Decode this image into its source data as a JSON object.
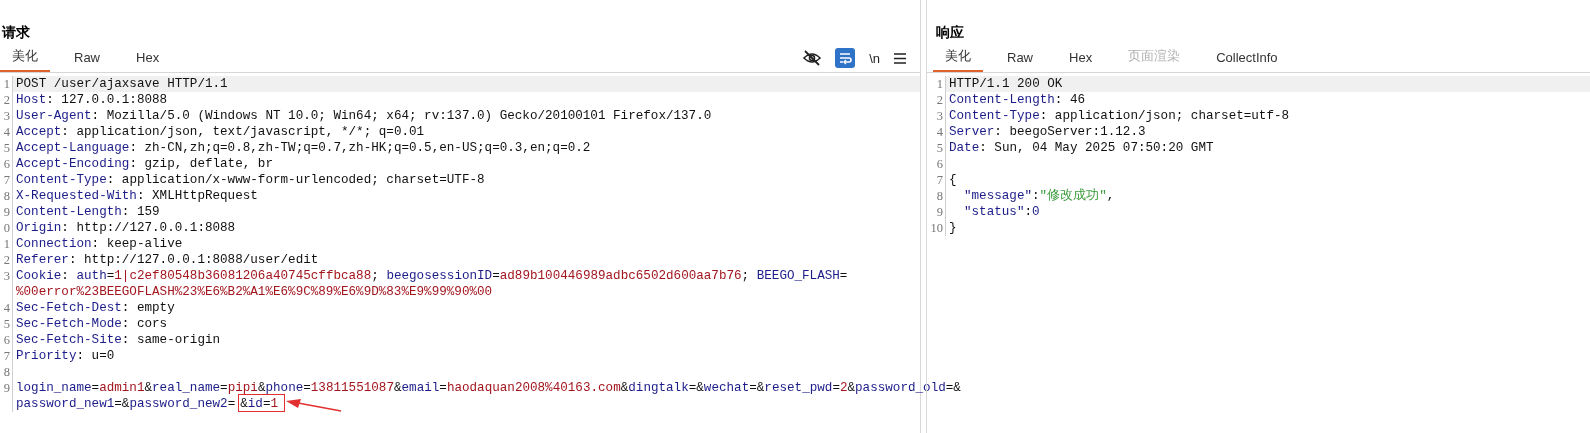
{
  "request": {
    "title": "请求",
    "tabs": [
      {
        "label": "美化",
        "selected": true,
        "disabled": false
      },
      {
        "label": "Raw",
        "selected": false,
        "disabled": false
      },
      {
        "label": "Hex",
        "selected": false,
        "disabled": false
      }
    ],
    "toolbar": [
      {
        "kind": "hide"
      },
      {
        "kind": "wrap"
      },
      {
        "kind": "text",
        "label": "\\n"
      },
      {
        "kind": "menu"
      }
    ],
    "lines": [
      {
        "number": "1",
        "current": true,
        "segments": [
          {
            "kind": "plain",
            "text": "POST /user/ajaxsave HTTP/1.1"
          }
        ]
      },
      {
        "number": "2",
        "current": false,
        "segments": [
          {
            "kind": "key",
            "text": "Host"
          },
          {
            "kind": "plain",
            "text": ": 127.0.0.1:8088"
          }
        ]
      },
      {
        "number": "3",
        "current": false,
        "segments": [
          {
            "kind": "key",
            "text": "User-Agent"
          },
          {
            "kind": "plain",
            "text": ": Mozilla/5.0 (Windows NT 10.0; Win64; x64; rv:137.0) Gecko/20100101 Firefox/137.0"
          }
        ]
      },
      {
        "number": "4",
        "current": false,
        "segments": [
          {
            "kind": "key",
            "text": "Accept"
          },
          {
            "kind": "plain",
            "text": ": application/json, text/javascript, */*; q=0.01"
          }
        ]
      },
      {
        "number": "5",
        "current": false,
        "segments": [
          {
            "kind": "key",
            "text": "Accept-Language"
          },
          {
            "kind": "plain",
            "text": ": zh-CN,zh;q=0.8,zh-TW;q=0.7,zh-HK;q=0.5,en-US;q=0.3,en;q=0.2"
          }
        ]
      },
      {
        "number": "6",
        "current": false,
        "segments": [
          {
            "kind": "key",
            "text": "Accept-Encoding"
          },
          {
            "kind": "plain",
            "text": ": gzip, deflate, br"
          }
        ]
      },
      {
        "number": "7",
        "current": false,
        "segments": [
          {
            "kind": "key",
            "text": "Content-Type"
          },
          {
            "kind": "plain",
            "text": ": application/x-www-form-urlencoded; charset=UTF-8"
          }
        ]
      },
      {
        "number": "8",
        "current": false,
        "segments": [
          {
            "kind": "key",
            "text": "X-Requested-With"
          },
          {
            "kind": "plain",
            "text": ": XMLHttpRequest"
          }
        ]
      },
      {
        "number": "9",
        "current": false,
        "segments": [
          {
            "kind": "key",
            "text": "Content-Length"
          },
          {
            "kind": "plain",
            "text": ": 159"
          }
        ]
      },
      {
        "number": "0",
        "current": false,
        "segments": [
          {
            "kind": "key",
            "text": "Origin"
          },
          {
            "kind": "plain",
            "text": ": http://127.0.0.1:8088"
          }
        ]
      },
      {
        "number": "1",
        "current": false,
        "segments": [
          {
            "kind": "key",
            "text": "Connection"
          },
          {
            "kind": "plain",
            "text": ": keep-alive"
          }
        ]
      },
      {
        "number": "2",
        "current": false,
        "segments": [
          {
            "kind": "key",
            "text": "Referer"
          },
          {
            "kind": "plain",
            "text": ": http://127.0.0.1:8088/user/edit"
          }
        ]
      },
      {
        "number": "3",
        "current": false,
        "segments": [
          {
            "kind": "key",
            "text": "Cookie"
          },
          {
            "kind": "plain",
            "text": ": "
          },
          {
            "kind": "key",
            "text": "auth"
          },
          {
            "kind": "plain",
            "text": "="
          },
          {
            "kind": "val",
            "text": "1|c2ef80548b36081206a40745cffbca88"
          },
          {
            "kind": "plain",
            "text": "; "
          },
          {
            "kind": "key",
            "text": "beegosessionID"
          },
          {
            "kind": "plain",
            "text": "="
          },
          {
            "kind": "val",
            "text": "ad89b100446989adbc6502d600aa7b76"
          },
          {
            "kind": "plain",
            "text": "; "
          },
          {
            "kind": "key",
            "text": "BEEGO_FLASH"
          },
          {
            "kind": "plain",
            "text": "="
          }
        ]
      },
      {
        "current": false,
        "segments": [
          {
            "kind": "val",
            "text": "%00error%23BEEGOFLASH%23%E6%B2%A1%E6%9C%89%E6%9D%83%E9%99%90%00"
          }
        ]
      },
      {
        "number": "4",
        "current": false,
        "segments": [
          {
            "kind": "key",
            "text": "Sec-Fetch-Dest"
          },
          {
            "kind": "plain",
            "text": ": empty"
          }
        ]
      },
      {
        "number": "5",
        "current": false,
        "segments": [
          {
            "kind": "key",
            "text": "Sec-Fetch-Mode"
          },
          {
            "kind": "plain",
            "text": ": cors"
          }
        ]
      },
      {
        "number": "6",
        "current": false,
        "segments": [
          {
            "kind": "key",
            "text": "Sec-Fetch-Site"
          },
          {
            "kind": "plain",
            "text": ": same-origin"
          }
        ]
      },
      {
        "number": "7",
        "current": false,
        "segments": [
          {
            "kind": "key",
            "text": "Priority"
          },
          {
            "kind": "plain",
            "text": ": u=0"
          }
        ]
      },
      {
        "number": "8",
        "current": false
      },
      {
        "number": "9",
        "current": false,
        "segments": [
          {
            "kind": "key",
            "text": "login_name"
          },
          {
            "kind": "plain",
            "text": "="
          },
          {
            "kind": "val",
            "text": "admin1"
          },
          {
            "kind": "plain",
            "text": "&"
          },
          {
            "kind": "key",
            "text": "real_name"
          },
          {
            "kind": "plain",
            "text": "="
          },
          {
            "kind": "val",
            "text": "pipi"
          },
          {
            "kind": "plain",
            "text": "&"
          },
          {
            "kind": "key",
            "text": "phone"
          },
          {
            "kind": "plain",
            "text": "="
          },
          {
            "kind": "val",
            "text": "13811551087"
          },
          {
            "kind": "plain",
            "text": "&"
          },
          {
            "kind": "key",
            "text": "email"
          },
          {
            "kind": "plain",
            "text": "="
          },
          {
            "kind": "val",
            "text": "haodaquan2008%40163.com"
          },
          {
            "kind": "plain",
            "text": "&"
          },
          {
            "kind": "key",
            "text": "dingtalk"
          },
          {
            "kind": "plain",
            "text": "=&"
          },
          {
            "kind": "key",
            "text": "wechat"
          },
          {
            "kind": "plain",
            "text": "=&"
          },
          {
            "kind": "key",
            "text": "reset_pwd"
          },
          {
            "kind": "plain",
            "text": "="
          },
          {
            "kind": "val",
            "text": "2"
          },
          {
            "kind": "plain",
            "text": "&"
          },
          {
            "kind": "key",
            "text": "password_old"
          },
          {
            "kind": "plain",
            "text": "=&"
          }
        ]
      },
      {
        "current": false,
        "segments": [
          {
            "kind": "key",
            "text": "password_new1"
          },
          {
            "kind": "plain",
            "text": "=&"
          },
          {
            "kind": "key",
            "text": "password_new2"
          },
          {
            "kind": "plain",
            "text": "="
          },
          {
            "kind": "callout",
            "segments": [
              {
                "kind": "plain",
                "text": "&"
              },
              {
                "kind": "key",
                "text": "id"
              },
              {
                "kind": "plain",
                "text": "="
              },
              {
                "kind": "val",
                "text": "1"
              }
            ]
          }
        ]
      }
    ]
  },
  "response": {
    "title": "响应",
    "tabs": [
      {
        "label": "美化",
        "selected": true,
        "disabled": false
      },
      {
        "label": "Raw",
        "selected": false,
        "disabled": false
      },
      {
        "label": "Hex",
        "selected": false,
        "disabled": false
      },
      {
        "label": "页面渲染",
        "selected": false,
        "disabled": true
      },
      {
        "label": "CollectInfo",
        "selected": false,
        "disabled": false
      }
    ],
    "lines": [
      {
        "number": "1",
        "current": true,
        "segments": [
          {
            "kind": "plain",
            "text": "HTTP/1.1 200 OK"
          }
        ]
      },
      {
        "number": "2",
        "current": false,
        "segments": [
          {
            "kind": "key",
            "text": "Content-Length"
          },
          {
            "kind": "plain",
            "text": ": 46"
          }
        ]
      },
      {
        "number": "3",
        "current": false,
        "segments": [
          {
            "kind": "key",
            "text": "Content-Type"
          },
          {
            "kind": "plain",
            "text": ": application/json; charset=utf-8"
          }
        ]
      },
      {
        "number": "4",
        "current": false,
        "segments": [
          {
            "kind": "key",
            "text": "Server"
          },
          {
            "kind": "plain",
            "text": ": beegoServer:1.12.3"
          }
        ]
      },
      {
        "number": "5",
        "current": false,
        "segments": [
          {
            "kind": "key",
            "text": "Date"
          },
          {
            "kind": "plain",
            "text": ": Sun, 04 May 2025 07:50:20 GMT"
          }
        ]
      },
      {
        "number": "6",
        "current": false
      },
      {
        "number": "7",
        "current": false,
        "segments": [
          {
            "kind": "plain",
            "text": "{"
          }
        ]
      },
      {
        "number": "8",
        "current": false,
        "segments": [
          {
            "kind": "json-key",
            "text": "\"message\""
          },
          {
            "kind": "plain",
            "text": ":"
          },
          {
            "kind": "str",
            "text": "\"修改成功\""
          },
          {
            "kind": "plain",
            "text": ","
          }
        ]
      },
      {
        "number": "9",
        "current": false,
        "segments": [
          {
            "kind": "json-key",
            "text": "\"status\""
          },
          {
            "kind": "plain",
            "text": ":"
          },
          {
            "kind": "num",
            "text": "0"
          }
        ]
      },
      {
        "number": "10",
        "current": false,
        "segments": [
          {
            "kind": "plain",
            "text": "}"
          }
        ]
      }
    ]
  }
}
